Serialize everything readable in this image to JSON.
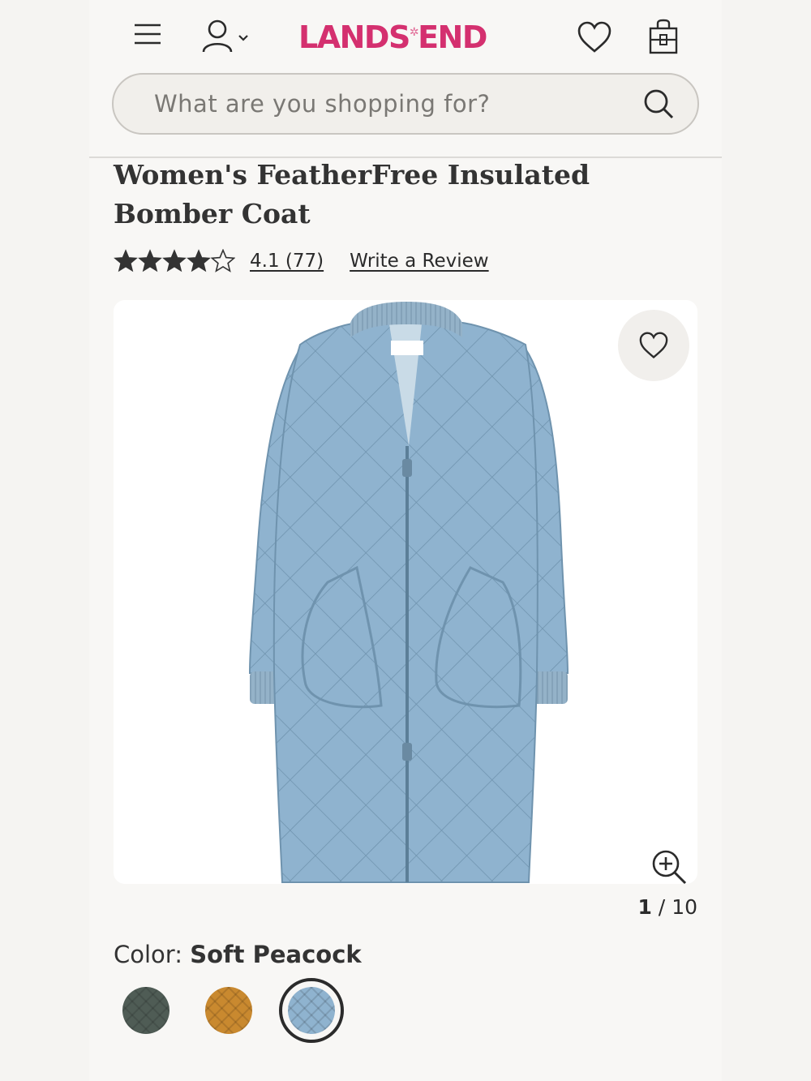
{
  "header": {
    "brand": "LANDS' END",
    "brand_parts": [
      "LANDS",
      "END"
    ],
    "brand_color": "#d4306f",
    "icons": [
      "menu-icon",
      "account-icon",
      "heart-icon",
      "shopping-bag-icon"
    ]
  },
  "search": {
    "placeholder": "What are you shopping for?"
  },
  "product": {
    "title": "Women's FeatherFree Insulated Bomber Coat",
    "rating_value": 4.1,
    "rating_max": 5,
    "rating_text": "4.1 (77)",
    "write_review": "Write a Review",
    "image_alt": "Soft Peacock quilted bomber coat",
    "coat_color": "#8fb3cf",
    "gallery_current": "1",
    "gallery_sep": " / ",
    "gallery_total": "10"
  },
  "color": {
    "label": "Color: ",
    "selected": "Soft Peacock",
    "swatches": [
      {
        "name": "dark green",
        "hex": "#4f5c55",
        "selected": false
      },
      {
        "name": "caramel",
        "hex": "#c9892f",
        "selected": false
      },
      {
        "name": "Soft Peacock",
        "hex": "#8fb3cf",
        "selected": true
      }
    ]
  }
}
